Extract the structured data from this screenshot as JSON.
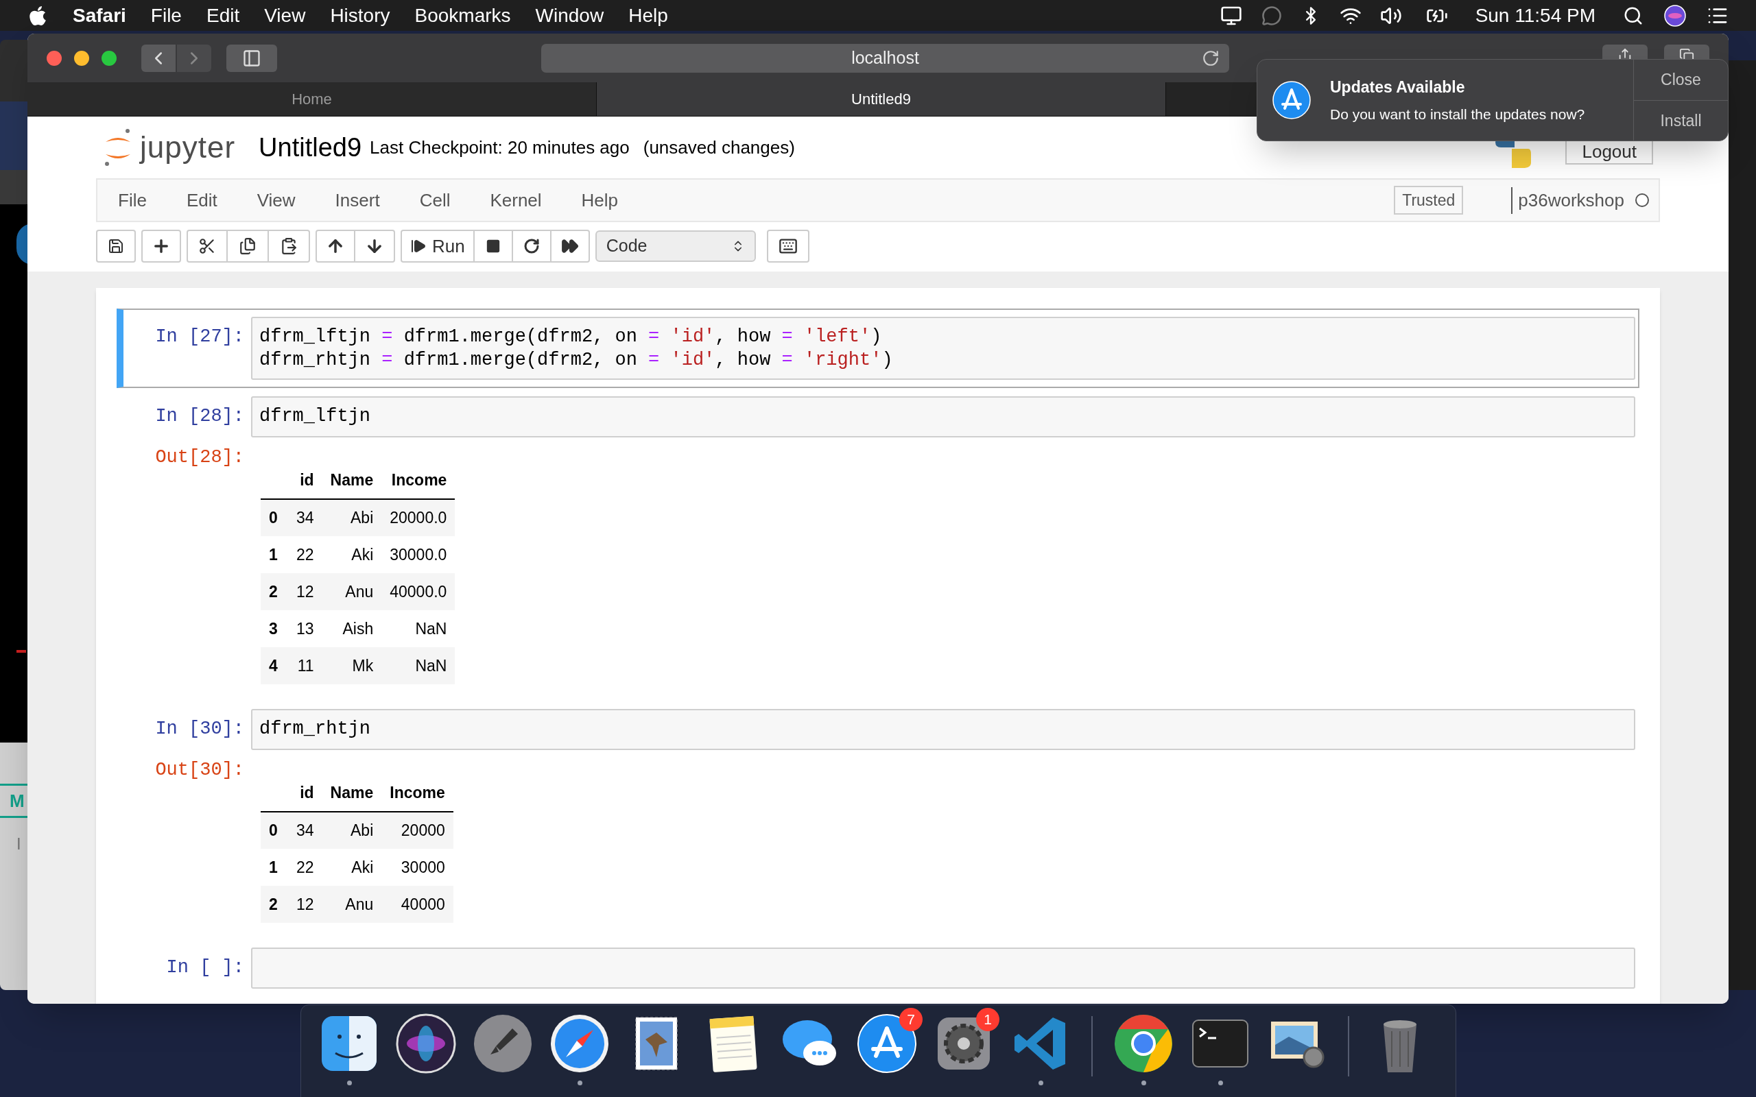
{
  "menu_bar": {
    "app": "Safari",
    "items": [
      "File",
      "Edit",
      "View",
      "History",
      "Bookmarks",
      "Window",
      "Help"
    ],
    "clock": "Sun 11:54 PM"
  },
  "background_window": {
    "texts": [
      "M",
      "I"
    ]
  },
  "browser": {
    "address": "localhost",
    "tabs": [
      {
        "label": "Home",
        "selected": false
      },
      {
        "label": "Untitled9",
        "selected": true
      }
    ]
  },
  "notebook": {
    "logo_text": "jupyter",
    "title": "Untitled9",
    "checkpoint": "Last Checkpoint: 20 minutes ago",
    "status": "(unsaved changes)",
    "logout": "Logout",
    "menus": [
      "File",
      "Edit",
      "View",
      "Insert",
      "Cell",
      "Kernel",
      "Help"
    ],
    "trusted": "Trusted",
    "kernel": "p36workshop",
    "kernel_busy": false,
    "run_label": "Run",
    "cell_type": "Code"
  },
  "cells": [
    {
      "prompt": "In [27]:",
      "selected": true,
      "lines": [
        [
          {
            "kind": "plain",
            "text": "dfrm_lftjn "
          },
          {
            "kind": "op",
            "text": "="
          },
          {
            "kind": "plain",
            "text": " dfrm1.merge(dfrm2, on "
          },
          {
            "kind": "op",
            "text": "= "
          },
          {
            "kind": "str",
            "text": "'id'"
          },
          {
            "kind": "plain",
            "text": ", how "
          },
          {
            "kind": "op",
            "text": "= "
          },
          {
            "kind": "str",
            "text": "'left'"
          },
          {
            "kind": "plain",
            "text": ")"
          }
        ],
        [
          {
            "kind": "plain",
            "text": "dfrm_rhtjn "
          },
          {
            "kind": "op",
            "text": "="
          },
          {
            "kind": "plain",
            "text": " dfrm1.merge(dfrm2, on "
          },
          {
            "kind": "op",
            "text": "= "
          },
          {
            "kind": "str",
            "text": "'id'"
          },
          {
            "kind": "plain",
            "text": ", how "
          },
          {
            "kind": "op",
            "text": "= "
          },
          {
            "kind": "str",
            "text": "'right'"
          },
          {
            "kind": "plain",
            "text": ")"
          }
        ]
      ]
    },
    {
      "prompt": "In [28]:",
      "selected": false,
      "lines": [
        [
          {
            "kind": "plain",
            "text": "dfrm_lftjn"
          }
        ]
      ],
      "output": {
        "prompt": "Out[28]:",
        "columns": [
          "",
          "id",
          "Name",
          "Income"
        ],
        "rows": [
          [
            "0",
            "34",
            "Abi",
            "20000.0"
          ],
          [
            "1",
            "22",
            "Aki",
            "30000.0"
          ],
          [
            "2",
            "12",
            "Anu",
            "40000.0"
          ],
          [
            "3",
            "13",
            "Aish",
            "NaN"
          ],
          [
            "4",
            "11",
            "Mk",
            "NaN"
          ]
        ]
      }
    },
    {
      "prompt": "In [30]:",
      "selected": false,
      "lines": [
        [
          {
            "kind": "plain",
            "text": "dfrm_rhtjn"
          }
        ]
      ],
      "output": {
        "prompt": "Out[30]:",
        "columns": [
          "",
          "id",
          "Name",
          "Income"
        ],
        "rows": [
          [
            "0",
            "34",
            "Abi",
            "20000"
          ],
          [
            "1",
            "22",
            "Aki",
            "30000"
          ],
          [
            "2",
            "12",
            "Anu",
            "40000"
          ]
        ]
      }
    },
    {
      "prompt": "In [ ]:",
      "selected": false
    }
  ],
  "notification": {
    "title": "Updates Available",
    "message": "Do you want to install the updates now?",
    "actions": [
      "Close",
      "Install"
    ]
  },
  "dock": [
    {
      "kind": "finder",
      "running": true
    },
    {
      "kind": "siri",
      "running": false
    },
    {
      "kind": "launchpad",
      "running": false
    },
    {
      "kind": "safari",
      "running": true
    },
    {
      "kind": "mail",
      "running": false
    },
    {
      "kind": "notes",
      "running": false
    },
    {
      "kind": "messages",
      "running": false
    },
    {
      "kind": "appstore",
      "running": false,
      "badge": "7"
    },
    {
      "kind": "settings",
      "running": false,
      "badge": "1"
    },
    {
      "kind": "vscode",
      "running": true
    },
    {
      "kind": "separator"
    },
    {
      "kind": "chrome",
      "running": true
    },
    {
      "kind": "terminal",
      "running": true
    },
    {
      "kind": "preview",
      "running": false
    },
    {
      "kind": "separator"
    },
    {
      "kind": "trash",
      "running": false
    }
  ]
}
